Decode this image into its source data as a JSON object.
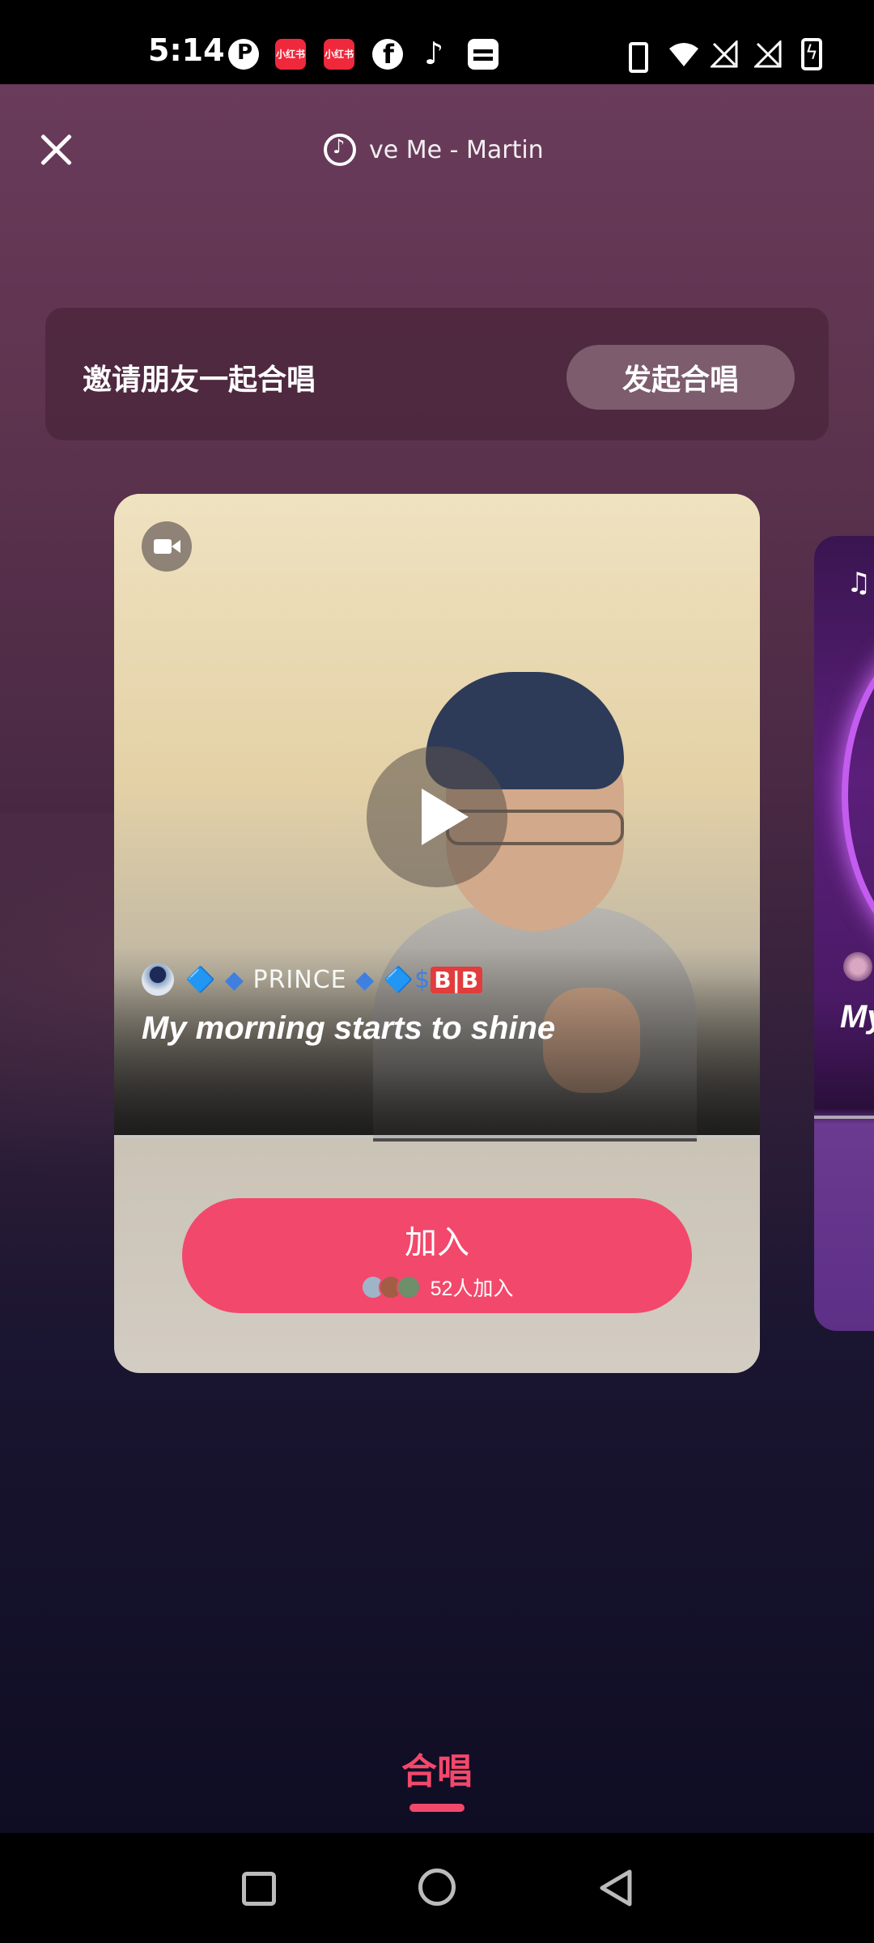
{
  "status_bar": {
    "time": "5:14",
    "notification_icons": [
      "p-app-icon",
      "xiaohongshu-icon",
      "xiaohongshu-icon",
      "facebook-icon",
      "tiktok-icon",
      "message-icon"
    ],
    "system_icons": [
      "vibrate-icon",
      "wifi-icon",
      "signal-off-icon",
      "signal-off-icon",
      "battery-charging-icon"
    ],
    "red_icon_text": "小红书"
  },
  "header": {
    "close_icon": "close-icon",
    "song_icon": "music-disc-icon",
    "song_title": "ve Me - Martin"
  },
  "invite": {
    "text": "邀请朋友一起合唱",
    "button_label": "发起合唱"
  },
  "card": {
    "media_type_icon": "video-camera-icon",
    "play_icon": "play-icon",
    "user": {
      "name_prefix": "🔷 ◆ ",
      "name_main": "PRINCE",
      "name_mid": " ◆ 🔷$",
      "name_badge": "B|B"
    },
    "lyric": "My morning starts to shine",
    "join": {
      "label": "加入",
      "count_text": "52人加入"
    }
  },
  "next_card": {
    "type_icon": "music-note-icon",
    "lyric_partial": "My"
  },
  "bottom_tab": {
    "label": "合唱",
    "accent_color": "#f2486b"
  },
  "nav_bar": {
    "buttons": [
      "recent-apps-icon",
      "home-icon",
      "back-icon"
    ]
  }
}
